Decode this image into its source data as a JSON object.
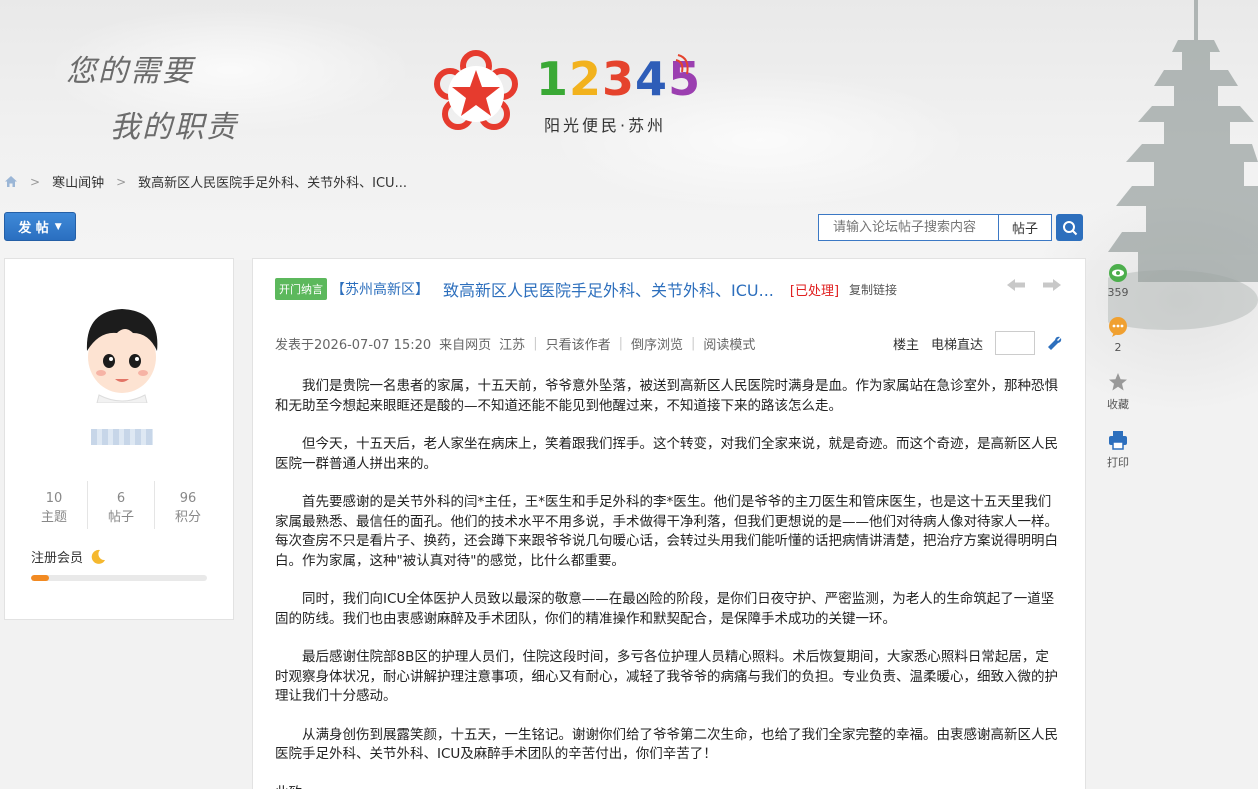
{
  "header": {
    "slogan_line1": "您的需要",
    "slogan_line2": "我的职责",
    "logo_digits": [
      "1",
      "2",
      "3",
      "4",
      "5"
    ],
    "logo_digit_colors": [
      "#3aa935",
      "#f2b21d",
      "#e5432d",
      "#2e5db8",
      "#9b3fb0"
    ],
    "logo_subtitle": "阳光便民·苏州",
    "brand_color": "#e63b2e"
  },
  "breadcrumb": {
    "items": [
      "寒山闻钟",
      "致高新区人民医院手足外科、关节外科、ICU..."
    ]
  },
  "toolbar": {
    "post_label": "发 帖",
    "search_placeholder": "请输入论坛帖子搜索内容",
    "search_type": "帖子"
  },
  "user": {
    "stats": [
      {
        "value": "10",
        "label": "主题"
      },
      {
        "value": "6",
        "label": "帖子"
      },
      {
        "value": "96",
        "label": "积分"
      }
    ],
    "member_label": "注册会员",
    "level_progress": 0.1
  },
  "post": {
    "tag": "开门纳言",
    "region": "【苏州高新区】",
    "title": "致高新区人民医院手足外科、关节外科、ICU...",
    "status": "[已处理]",
    "copy_link": "复制链接",
    "meta": {
      "posted": "发表于2026-07-07 15:20",
      "source": "来自网页",
      "location": "江苏",
      "only_author": "只看该作者",
      "reverse": "倒序浏览",
      "read_mode": "阅读模式",
      "floor": "楼主",
      "elevator": "电梯直达"
    },
    "paragraphs": [
      "我们是贵院一名患者的家属，十五天前，爷爷意外坠落，被送到高新区人民医院时满身是血。作为家属站在急诊室外，那种恐惧和无助至今想起来眼眶还是酸的—不知道还能不能见到他醒过来，不知道接下来的路该怎么走。",
      "但今天，十五天后，老人家坐在病床上，笑着跟我们挥手。这个转变，对我们全家来说，就是奇迹。而这个奇迹，是高新区人民医院一群普通人拼出来的。",
      "首先要感谢的是关节外科的闫*主任，王*医生和手足外科的李*医生。他们是爷爷的主刀医生和管床医生，也是这十五天里我们家属最熟悉、最信任的面孔。他们的技术水平不用多说，手术做得干净利落，但我们更想说的是——他们对待病人像对待家人一样。每次查房不只是看片子、换药，还会蹲下来跟爷爷说几句暖心话，会转过头用我们能听懂的话把病情讲清楚，把治疗方案说得明明白白。作为家属，这种\"被认真对待\"的感觉，比什么都重要。",
      "同时，我们向ICU全体医护人员致以最深的敬意——在最凶险的阶段，是你们日夜守护、严密监测，为老人的生命筑起了一道坚固的防线。我们也由衷感谢麻醉及手术团队，你们的精准操作和默契配合，是保障手术成功的关键一环。",
      "最后感谢住院部8B区的护理人员们，住院这段时间，多亏各位护理人员精心照料。术后恢复期间，大家悉心照料日常起居，定时观察身体状况，耐心讲解护理注意事项，细心又有耐心，减轻了我爷爷的病痛与我们的负担。专业负责、温柔暖心，细致入微的护理让我们十分感动。",
      "从满身创伤到展露笑颜，十五天，一生铭记。谢谢你们给了爷爷第二次生命，也给了我们全家完整的幸福。由衷感谢高新区人民医院手足外科、关节外科、ICU及麻醉手术团队的辛苦付出，你们辛苦了！"
    ],
    "closing": "此致"
  },
  "side_actions": [
    {
      "icon": "eye-icon",
      "label": "359",
      "color": "#4cae4c"
    },
    {
      "icon": "comment-icon",
      "label": "2",
      "color": "#f0a030"
    },
    {
      "icon": "star-icon",
      "label": "收藏",
      "color": "#999999"
    },
    {
      "icon": "printer-icon",
      "label": "打印",
      "color": "#2d6fbd"
    }
  ]
}
